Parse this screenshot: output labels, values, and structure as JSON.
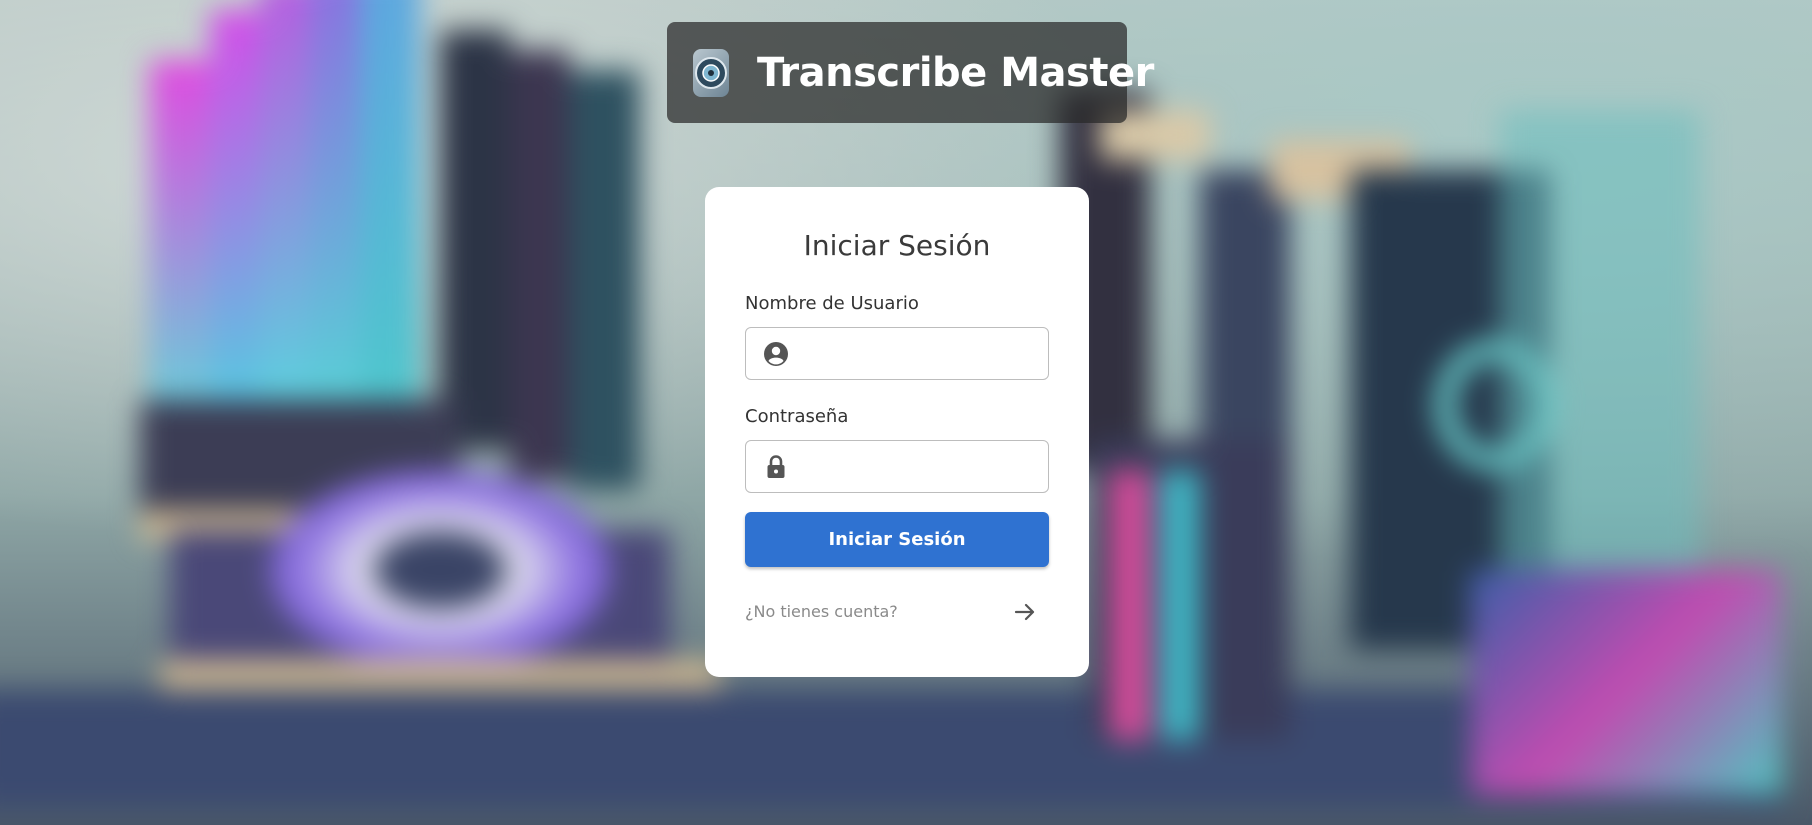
{
  "brand": {
    "title": "Transcribe Master",
    "logo_icon": "logo-icon"
  },
  "login": {
    "title": "Iniciar Sesión",
    "username_label": "Nombre de Usuario",
    "username_value": "",
    "username_icon": "user-circle-icon",
    "password_label": "Contraseña",
    "password_value": "",
    "password_icon": "lock-icon",
    "submit_label": "Iniciar Sesión",
    "signup_prompt": "¿No tienes cuenta?",
    "signup_icon": "arrow-right-icon"
  },
  "colors": {
    "primary_button": "#2f72d1",
    "card_background": "#ffffff",
    "brand_background": "#282828"
  }
}
